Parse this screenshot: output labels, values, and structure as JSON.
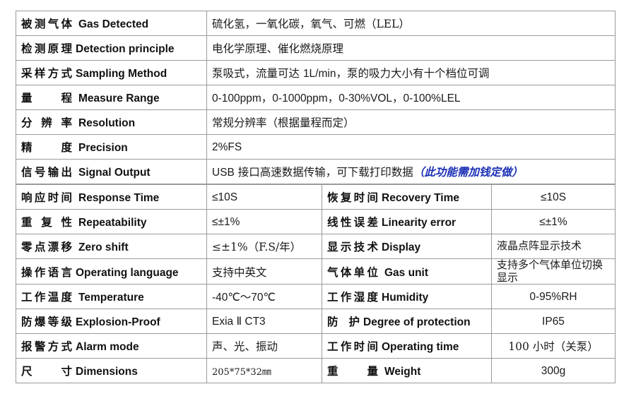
{
  "document": {
    "title": "Gas Detector Specification Table",
    "accent_note_color": "#1a2fb5",
    "border_color": "#9a9a9a"
  },
  "rows": [
    {
      "layout": "two-column",
      "label_cn": "被测气体",
      "label_en": "Gas Detected",
      "value": "硫化氢，一氧化碳，氧气、可燃（LEL）"
    },
    {
      "layout": "two-column",
      "label_cn": "检测原理",
      "label_en": "Detection principle",
      "value": "电化学原理、催化燃烧原理"
    },
    {
      "layout": "two-column",
      "label_cn": "采样方式",
      "label_en": "Sampling Method",
      "value_pre": "泵吸式，流量可达 ",
      "value_lat": "1L/min",
      "value_post": "，泵的吸力大小有十个档位可调"
    },
    {
      "layout": "two-column",
      "label_cn": "量  程",
      "label_en": "Measure Range",
      "value_lat": "0-100ppm，0-1000ppm，0-30%VOL，0-100%LEL"
    },
    {
      "layout": "two-column",
      "label_cn": "分 辨 率",
      "label_en": "Resolution",
      "value": "常规分辨率（根据量程而定）"
    },
    {
      "layout": "two-column",
      "label_cn": "精  度",
      "label_en": "Precision",
      "value_lat": "2%FS"
    },
    {
      "layout": "two-column",
      "label_cn": "信号输出",
      "label_en": "Signal Output",
      "value_lat": "USB",
      "value_post": " 接口高速数据传输，可下载打印数据",
      "value_note": "（此功能需加钱定做）"
    },
    {
      "layout": "four-column",
      "label_cn": "响应时间",
      "label_en": "Response Time",
      "value": "≤10S",
      "label2_cn": "恢复时间",
      "label2_en": "Recovery Time",
      "value2": "≤10S"
    },
    {
      "layout": "four-column",
      "label_cn": "重 复 性",
      "label_en": "Repeatability",
      "value": "≤±1%",
      "label2_cn": "线性误差",
      "label2_en": "Linearity error",
      "value2": "≤±1%"
    },
    {
      "layout": "four-column",
      "label_cn": "零点漂移",
      "label_en": "Zero shift",
      "value": "≤±1%（F.S/年）",
      "label2_cn": "显示技术",
      "label2_en": "Display",
      "value2": "液晶点阵显示技术"
    },
    {
      "layout": "four-column",
      "label_cn": "操作语言",
      "label_en": "Operating language",
      "value": "支持中英文",
      "label2_cn": "气体单位",
      "label2_en": "Gas unit",
      "value2": "支持多个气体单位切换显示"
    },
    {
      "layout": "four-column",
      "label_cn": "工作温度",
      "label_en": "Temperature",
      "value": "-40℃～70℃",
      "label2_cn": "工作湿度",
      "label2_en": "Humidity",
      "value2": "0-95%RH"
    },
    {
      "layout": "four-column",
      "label_cn": "防爆等级",
      "label_en": "Explosion-Proof",
      "value": "Exia Ⅱ CT3",
      "label2_cn": "防  护",
      "label2_en": "Degree of protection",
      "value2": "IP65"
    },
    {
      "layout": "four-column",
      "label_cn": "报警方式",
      "label_en": "Alarm mode",
      "value": "声、光、振动",
      "label2_cn": "工作时间",
      "label2_en": "Operating time",
      "value2": "100 小时（关泵）"
    },
    {
      "layout": "four-column",
      "label_cn": "尺  寸",
      "label_en": "Dimensions",
      "value": "205*75*32㎜",
      "label2_cn": "重  量",
      "label2_en": "Weight",
      "value2": "300g"
    }
  ]
}
